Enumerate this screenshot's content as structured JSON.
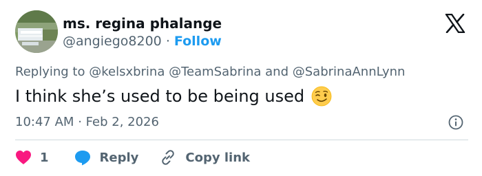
{
  "tweet": {
    "display_name": "ms. regina phalange",
    "handle": "@angiego8200",
    "separator": "·",
    "follow_label": "Follow",
    "reply_prefix": "Replying to",
    "mentions": [
      "@kelsxbrina",
      "@TeamSabrina",
      "@SabrinaAnnLynn"
    ],
    "mention_joiner": "and",
    "text": "I think she’s used to be being used",
    "emoji": "winking-face",
    "time": "10:47 AM",
    "date": "Feb 2, 2026"
  },
  "actions": {
    "like_count": "1",
    "reply_label": "Reply",
    "copy_label": "Copy link"
  },
  "icons": {
    "logo": "x-logo-icon",
    "info": "info-icon",
    "like": "heart-icon",
    "reply": "speech-bubble-icon",
    "copy": "link-icon"
  },
  "colors": {
    "follow": "#1d9bf0",
    "like": "#f91880",
    "reply": "#1d9bf0",
    "text": "#0f1419",
    "muted": "#536471"
  }
}
